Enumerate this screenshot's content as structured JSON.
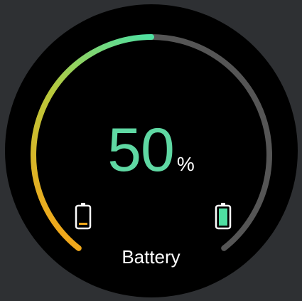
{
  "battery": {
    "level_percent": 50,
    "value_text": "50",
    "unit_text": "%",
    "label": "Battery"
  },
  "icons": {
    "low": "battery-low-icon",
    "full": "battery-full-icon"
  },
  "colors": {
    "background": "#2e3033",
    "face": "#000000",
    "value": "#5fd8a3",
    "unit": "#ffffff",
    "label": "#ffffff",
    "track": "#555555",
    "gradient_start": "#f0a81b",
    "gradient_mid": "#b9c93b",
    "gradient_end": "#4fe0a2",
    "low_fill": "#f0a81b",
    "full_fill": "#4fe0a2",
    "icon_outline": "#ffffff"
  }
}
